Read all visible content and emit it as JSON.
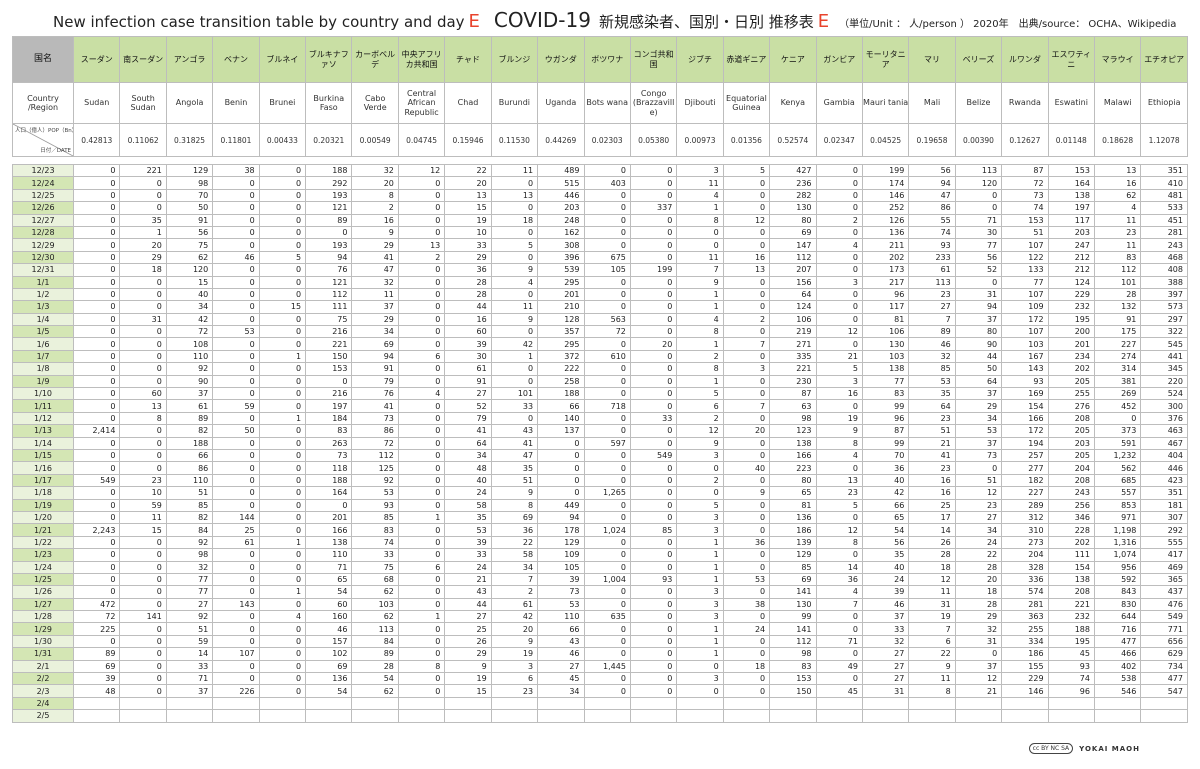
{
  "header": {
    "title_en": "New infection case transition table by country and day",
    "mark": "E",
    "covid": "COVID-19",
    "title_ja": "新規感染者、国別・日別 推移表",
    "mark2": "E",
    "unit": "（単位/Unit ： 人/person ） 2020年",
    "source": "出典/source： OCHA、Wikipedia"
  },
  "row_labels": {
    "ja": "国名",
    "en": "Country /Region",
    "pop_top": "人口（億人）POP（Bn）",
    "pop_bottom": "日付／DATE"
  },
  "countries_ja": [
    "スーダン",
    "南スーダン",
    "アンゴラ",
    "ベナン",
    "ブルネイ",
    "ブルキナファソ",
    "カーボベルデ",
    "中央アフリカ共和国",
    "チャド",
    "ブルンジ",
    "ウガンダ",
    "ボツワナ",
    "コンゴ共和国",
    "ジブチ",
    "赤道ギニア",
    "ケニア",
    "ガンビア",
    "モーリタニア",
    "マリ",
    "ベリーズ",
    "ルワンダ",
    "エスワティニ",
    "マラウイ",
    "エチオピア"
  ],
  "countries_en": [
    "Sudan",
    "South Sudan",
    "Angola",
    "Benin",
    "Brunei",
    "Burkina Faso",
    "Cabo Verde",
    "Central African Republic",
    "Chad",
    "Burundi",
    "Uganda",
    "Bots wana",
    "Congo (Brazzavill e)",
    "Djibouti",
    "Equatorial Guinea",
    "Kenya",
    "Gambia",
    "Mauri tania",
    "Mali",
    "Belize",
    "Rwanda",
    "Eswatini",
    "Malawi",
    "Ethiopia"
  ],
  "population": [
    "0.42813",
    "0.11062",
    "0.31825",
    "0.11801",
    "0.00433",
    "0.20321",
    "0.00549",
    "0.04745",
    "0.15946",
    "0.11530",
    "0.44269",
    "0.02303",
    "0.05380",
    "0.00973",
    "0.01356",
    "0.52574",
    "0.02347",
    "0.04525",
    "0.19658",
    "0.00390",
    "0.12627",
    "0.01148",
    "0.18628",
    "1.12078"
  ],
  "rows": [
    {
      "date": "12/23",
      "values": [
        "0",
        "221",
        "129",
        "38",
        "0",
        "188",
        "32",
        "12",
        "22",
        "11",
        "489",
        "0",
        "0",
        "3",
        "5",
        "427",
        "0",
        "199",
        "56",
        "113",
        "87",
        "153",
        "13",
        "351"
      ]
    },
    {
      "date": "12/24",
      "values": [
        "0",
        "0",
        "98",
        "0",
        "0",
        "292",
        "20",
        "0",
        "20",
        "0",
        "515",
        "403",
        "0",
        "11",
        "0",
        "236",
        "0",
        "174",
        "94",
        "120",
        "72",
        "164",
        "16",
        "410"
      ]
    },
    {
      "date": "12/25",
      "values": [
        "0",
        "0",
        "70",
        "0",
        "0",
        "193",
        "8",
        "0",
        "13",
        "13",
        "446",
        "0",
        "0",
        "4",
        "0",
        "282",
        "0",
        "146",
        "47",
        "0",
        "73",
        "138",
        "62",
        "481"
      ]
    },
    {
      "date": "12/26",
      "values": [
        "0",
        "0",
        "50",
        "0",
        "0",
        "121",
        "2",
        "0",
        "15",
        "0",
        "203",
        "0",
        "337",
        "1",
        "0",
        "130",
        "0",
        "252",
        "86",
        "0",
        "74",
        "197",
        "4",
        "533"
      ]
    },
    {
      "date": "12/27",
      "values": [
        "0",
        "35",
        "91",
        "0",
        "0",
        "89",
        "16",
        "0",
        "19",
        "18",
        "248",
        "0",
        "0",
        "8",
        "12",
        "80",
        "2",
        "126",
        "55",
        "71",
        "153",
        "117",
        "11",
        "451"
      ]
    },
    {
      "date": "12/28",
      "values": [
        "0",
        "1",
        "56",
        "0",
        "0",
        "0",
        "9",
        "0",
        "10",
        "0",
        "162",
        "0",
        "0",
        "0",
        "0",
        "69",
        "0",
        "136",
        "74",
        "30",
        "51",
        "203",
        "23",
        "281"
      ]
    },
    {
      "date": "12/29",
      "values": [
        "0",
        "20",
        "75",
        "0",
        "0",
        "193",
        "29",
        "13",
        "33",
        "5",
        "308",
        "0",
        "0",
        "0",
        "0",
        "147",
        "4",
        "211",
        "93",
        "77",
        "107",
        "247",
        "11",
        "243"
      ]
    },
    {
      "date": "12/30",
      "values": [
        "0",
        "29",
        "62",
        "46",
        "5",
        "94",
        "41",
        "2",
        "29",
        "0",
        "396",
        "675",
        "0",
        "11",
        "16",
        "112",
        "0",
        "202",
        "233",
        "56",
        "122",
        "212",
        "83",
        "468"
      ]
    },
    {
      "date": "12/31",
      "values": [
        "0",
        "18",
        "120",
        "0",
        "0",
        "76",
        "47",
        "0",
        "36",
        "9",
        "539",
        "105",
        "199",
        "7",
        "13",
        "207",
        "0",
        "173",
        "61",
        "52",
        "133",
        "212",
        "112",
        "408"
      ]
    },
    {
      "date": "1/1",
      "values": [
        "0",
        "0",
        "15",
        "0",
        "0",
        "121",
        "32",
        "0",
        "28",
        "4",
        "295",
        "0",
        "0",
        "9",
        "0",
        "156",
        "3",
        "217",
        "113",
        "0",
        "77",
        "124",
        "101",
        "388"
      ]
    },
    {
      "date": "1/2",
      "values": [
        "0",
        "0",
        "40",
        "0",
        "0",
        "112",
        "11",
        "0",
        "28",
        "0",
        "201",
        "0",
        "0",
        "1",
        "0",
        "64",
        "0",
        "96",
        "23",
        "31",
        "107",
        "229",
        "28",
        "397"
      ]
    },
    {
      "date": "1/3",
      "values": [
        "0",
        "0",
        "34",
        "0",
        "15",
        "111",
        "37",
        "0",
        "44",
        "11",
        "210",
        "0",
        "0",
        "1",
        "0",
        "124",
        "0",
        "117",
        "27",
        "94",
        "109",
        "232",
        "132",
        "573"
      ]
    },
    {
      "date": "1/4",
      "values": [
        "0",
        "31",
        "42",
        "0",
        "0",
        "75",
        "29",
        "0",
        "16",
        "9",
        "128",
        "563",
        "0",
        "4",
        "2",
        "106",
        "0",
        "81",
        "7",
        "37",
        "172",
        "195",
        "91",
        "297"
      ]
    },
    {
      "date": "1/5",
      "values": [
        "0",
        "0",
        "72",
        "53",
        "0",
        "216",
        "34",
        "0",
        "60",
        "0",
        "357",
        "72",
        "0",
        "8",
        "0",
        "219",
        "12",
        "106",
        "89",
        "80",
        "107",
        "200",
        "175",
        "322"
      ]
    },
    {
      "date": "1/6",
      "values": [
        "0",
        "0",
        "108",
        "0",
        "0",
        "221",
        "69",
        "0",
        "39",
        "42",
        "295",
        "0",
        "20",
        "1",
        "7",
        "271",
        "0",
        "130",
        "46",
        "90",
        "103",
        "201",
        "227",
        "545"
      ]
    },
    {
      "date": "1/7",
      "values": [
        "0",
        "0",
        "110",
        "0",
        "1",
        "150",
        "94",
        "6",
        "30",
        "1",
        "372",
        "610",
        "0",
        "2",
        "0",
        "335",
        "21",
        "103",
        "32",
        "44",
        "167",
        "234",
        "274",
        "441"
      ]
    },
    {
      "date": "1/8",
      "values": [
        "0",
        "0",
        "92",
        "0",
        "0",
        "153",
        "91",
        "0",
        "61",
        "0",
        "222",
        "0",
        "0",
        "8",
        "3",
        "221",
        "5",
        "138",
        "85",
        "50",
        "143",
        "202",
        "314",
        "345"
      ]
    },
    {
      "date": "1/9",
      "values": [
        "0",
        "0",
        "90",
        "0",
        "0",
        "0",
        "79",
        "0",
        "91",
        "0",
        "258",
        "0",
        "0",
        "1",
        "0",
        "230",
        "3",
        "77",
        "53",
        "64",
        "93",
        "205",
        "381",
        "220"
      ]
    },
    {
      "date": "1/10",
      "values": [
        "0",
        "60",
        "37",
        "0",
        "0",
        "216",
        "76",
        "4",
        "27",
        "101",
        "188",
        "0",
        "0",
        "5",
        "0",
        "87",
        "16",
        "83",
        "35",
        "37",
        "169",
        "255",
        "269",
        "524"
      ]
    },
    {
      "date": "1/11",
      "values": [
        "0",
        "13",
        "61",
        "59",
        "0",
        "197",
        "41",
        "0",
        "52",
        "33",
        "66",
        "718",
        "0",
        "6",
        "7",
        "63",
        "0",
        "99",
        "64",
        "29",
        "154",
        "276",
        "452",
        "300"
      ]
    },
    {
      "date": "1/12",
      "values": [
        "0",
        "8",
        "89",
        "0",
        "1",
        "184",
        "73",
        "0",
        "79",
        "0",
        "140",
        "0",
        "33",
        "2",
        "0",
        "98",
        "19",
        "96",
        "23",
        "34",
        "166",
        "208",
        "0",
        "376"
      ]
    },
    {
      "date": "1/13",
      "values": [
        "2,414",
        "0",
        "82",
        "50",
        "0",
        "83",
        "86",
        "0",
        "41",
        "43",
        "137",
        "0",
        "0",
        "12",
        "20",
        "123",
        "9",
        "87",
        "51",
        "53",
        "172",
        "205",
        "373",
        "463"
      ]
    },
    {
      "date": "1/14",
      "values": [
        "0",
        "0",
        "188",
        "0",
        "0",
        "263",
        "72",
        "0",
        "64",
        "41",
        "0",
        "597",
        "0",
        "9",
        "0",
        "138",
        "8",
        "99",
        "21",
        "37",
        "194",
        "203",
        "591",
        "467"
      ]
    },
    {
      "date": "1/15",
      "values": [
        "0",
        "0",
        "66",
        "0",
        "0",
        "73",
        "112",
        "0",
        "34",
        "47",
        "0",
        "0",
        "549",
        "3",
        "0",
        "166",
        "4",
        "70",
        "41",
        "73",
        "257",
        "205",
        "1,232",
        "404"
      ]
    },
    {
      "date": "1/16",
      "values": [
        "0",
        "0",
        "86",
        "0",
        "0",
        "118",
        "125",
        "0",
        "48",
        "35",
        "0",
        "0",
        "0",
        "0",
        "40",
        "223",
        "0",
        "36",
        "23",
        "0",
        "277",
        "204",
        "562",
        "446"
      ]
    },
    {
      "date": "1/17",
      "values": [
        "549",
        "23",
        "110",
        "0",
        "0",
        "188",
        "92",
        "0",
        "40",
        "51",
        "0",
        "0",
        "0",
        "2",
        "0",
        "80",
        "13",
        "40",
        "16",
        "51",
        "182",
        "208",
        "685",
        "423"
      ]
    },
    {
      "date": "1/18",
      "values": [
        "0",
        "10",
        "51",
        "0",
        "0",
        "164",
        "53",
        "0",
        "24",
        "9",
        "0",
        "1,265",
        "0",
        "0",
        "9",
        "65",
        "23",
        "42",
        "16",
        "12",
        "227",
        "243",
        "557",
        "351"
      ]
    },
    {
      "date": "1/19",
      "values": [
        "0",
        "59",
        "85",
        "0",
        "0",
        "0",
        "93",
        "0",
        "58",
        "8",
        "449",
        "0",
        "0",
        "5",
        "0",
        "81",
        "5",
        "66",
        "25",
        "23",
        "289",
        "256",
        "853",
        "181"
      ]
    },
    {
      "date": "1/20",
      "values": [
        "0",
        "11",
        "82",
        "144",
        "0",
        "201",
        "85",
        "1",
        "35",
        "69",
        "94",
        "0",
        "0",
        "3",
        "0",
        "136",
        "0",
        "65",
        "17",
        "27",
        "312",
        "346",
        "971",
        "307"
      ]
    },
    {
      "date": "1/21",
      "values": [
        "2,243",
        "15",
        "84",
        "25",
        "0",
        "166",
        "83",
        "0",
        "53",
        "36",
        "178",
        "1,024",
        "85",
        "3",
        "0",
        "186",
        "12",
        "54",
        "14",
        "34",
        "310",
        "228",
        "1,198",
        "292"
      ]
    },
    {
      "date": "1/22",
      "values": [
        "0",
        "0",
        "92",
        "61",
        "1",
        "138",
        "74",
        "0",
        "39",
        "22",
        "129",
        "0",
        "0",
        "1",
        "36",
        "139",
        "8",
        "56",
        "26",
        "24",
        "273",
        "202",
        "1,316",
        "555"
      ]
    },
    {
      "date": "1/23",
      "values": [
        "0",
        "0",
        "98",
        "0",
        "0",
        "110",
        "33",
        "0",
        "33",
        "58",
        "109",
        "0",
        "0",
        "1",
        "0",
        "129",
        "0",
        "35",
        "28",
        "22",
        "204",
        "111",
        "1,074",
        "417"
      ]
    },
    {
      "date": "1/24",
      "values": [
        "0",
        "0",
        "32",
        "0",
        "0",
        "71",
        "75",
        "6",
        "24",
        "34",
        "105",
        "0",
        "0",
        "1",
        "0",
        "85",
        "14",
        "40",
        "18",
        "28",
        "328",
        "154",
        "956",
        "469"
      ]
    },
    {
      "date": "1/25",
      "values": [
        "0",
        "0",
        "77",
        "0",
        "0",
        "65",
        "68",
        "0",
        "21",
        "7",
        "39",
        "1,004",
        "93",
        "1",
        "53",
        "69",
        "36",
        "24",
        "12",
        "20",
        "336",
        "138",
        "592",
        "365"
      ]
    },
    {
      "date": "1/26",
      "values": [
        "0",
        "0",
        "77",
        "0",
        "1",
        "54",
        "62",
        "0",
        "43",
        "2",
        "73",
        "0",
        "0",
        "3",
        "0",
        "141",
        "4",
        "39",
        "11",
        "18",
        "574",
        "208",
        "843",
        "437"
      ]
    },
    {
      "date": "1/27",
      "values": [
        "472",
        "0",
        "27",
        "143",
        "0",
        "60",
        "103",
        "0",
        "44",
        "61",
        "53",
        "0",
        "0",
        "3",
        "38",
        "130",
        "7",
        "46",
        "31",
        "28",
        "281",
        "221",
        "830",
        "476"
      ]
    },
    {
      "date": "1/28",
      "values": [
        "72",
        "141",
        "92",
        "0",
        "4",
        "160",
        "62",
        "1",
        "27",
        "42",
        "110",
        "635",
        "0",
        "3",
        "0",
        "99",
        "0",
        "37",
        "19",
        "29",
        "363",
        "232",
        "644",
        "549"
      ]
    },
    {
      "date": "1/29",
      "values": [
        "225",
        "0",
        "51",
        "0",
        "0",
        "46",
        "113",
        "0",
        "25",
        "20",
        "66",
        "0",
        "0",
        "1",
        "24",
        "141",
        "0",
        "33",
        "7",
        "32",
        "255",
        "188",
        "716",
        "771"
      ]
    },
    {
      "date": "1/30",
      "values": [
        "0",
        "0",
        "59",
        "0",
        "0",
        "157",
        "84",
        "0",
        "26",
        "9",
        "43",
        "0",
        "0",
        "1",
        "0",
        "112",
        "71",
        "32",
        "6",
        "31",
        "334",
        "195",
        "477",
        "656"
      ]
    },
    {
      "date": "1/31",
      "values": [
        "89",
        "0",
        "14",
        "107",
        "0",
        "102",
        "89",
        "0",
        "29",
        "19",
        "46",
        "0",
        "0",
        "1",
        "0",
        "98",
        "0",
        "27",
        "22",
        "0",
        "186",
        "45",
        "466",
        "629"
      ]
    },
    {
      "date": "2/1",
      "values": [
        "69",
        "0",
        "33",
        "0",
        "0",
        "69",
        "28",
        "8",
        "9",
        "3",
        "27",
        "1,445",
        "0",
        "0",
        "18",
        "83",
        "49",
        "27",
        "9",
        "37",
        "155",
        "93",
        "402",
        "734"
      ]
    },
    {
      "date": "2/2",
      "values": [
        "39",
        "0",
        "71",
        "0",
        "0",
        "136",
        "54",
        "0",
        "19",
        "6",
        "45",
        "0",
        "0",
        "3",
        "0",
        "153",
        "0",
        "27",
        "11",
        "12",
        "229",
        "74",
        "538",
        "477"
      ]
    },
    {
      "date": "2/3",
      "values": [
        "48",
        "0",
        "37",
        "226",
        "0",
        "54",
        "62",
        "0",
        "15",
        "23",
        "34",
        "0",
        "0",
        "0",
        "0",
        "150",
        "45",
        "31",
        "8",
        "21",
        "146",
        "96",
        "546",
        "547"
      ]
    },
    {
      "date": "2/4",
      "values": [
        "",
        "",
        "",
        "",
        "",
        "",
        "",
        "",
        "",
        "",
        "",
        "",
        "",
        "",
        "",
        "",
        "",
        "",
        "",
        "",
        "",
        "",
        "",
        ""
      ]
    },
    {
      "date": "2/5",
      "values": [
        "",
        "",
        "",
        "",
        "",
        "",
        "",
        "",
        "",
        "",
        "",
        "",
        "",
        "",
        "",
        "",
        "",
        "",
        "",
        "",
        "",
        "",
        "",
        ""
      ]
    }
  ],
  "footer": {
    "license": "cc BY NC SA",
    "brand": "YOKAI MAOH"
  }
}
